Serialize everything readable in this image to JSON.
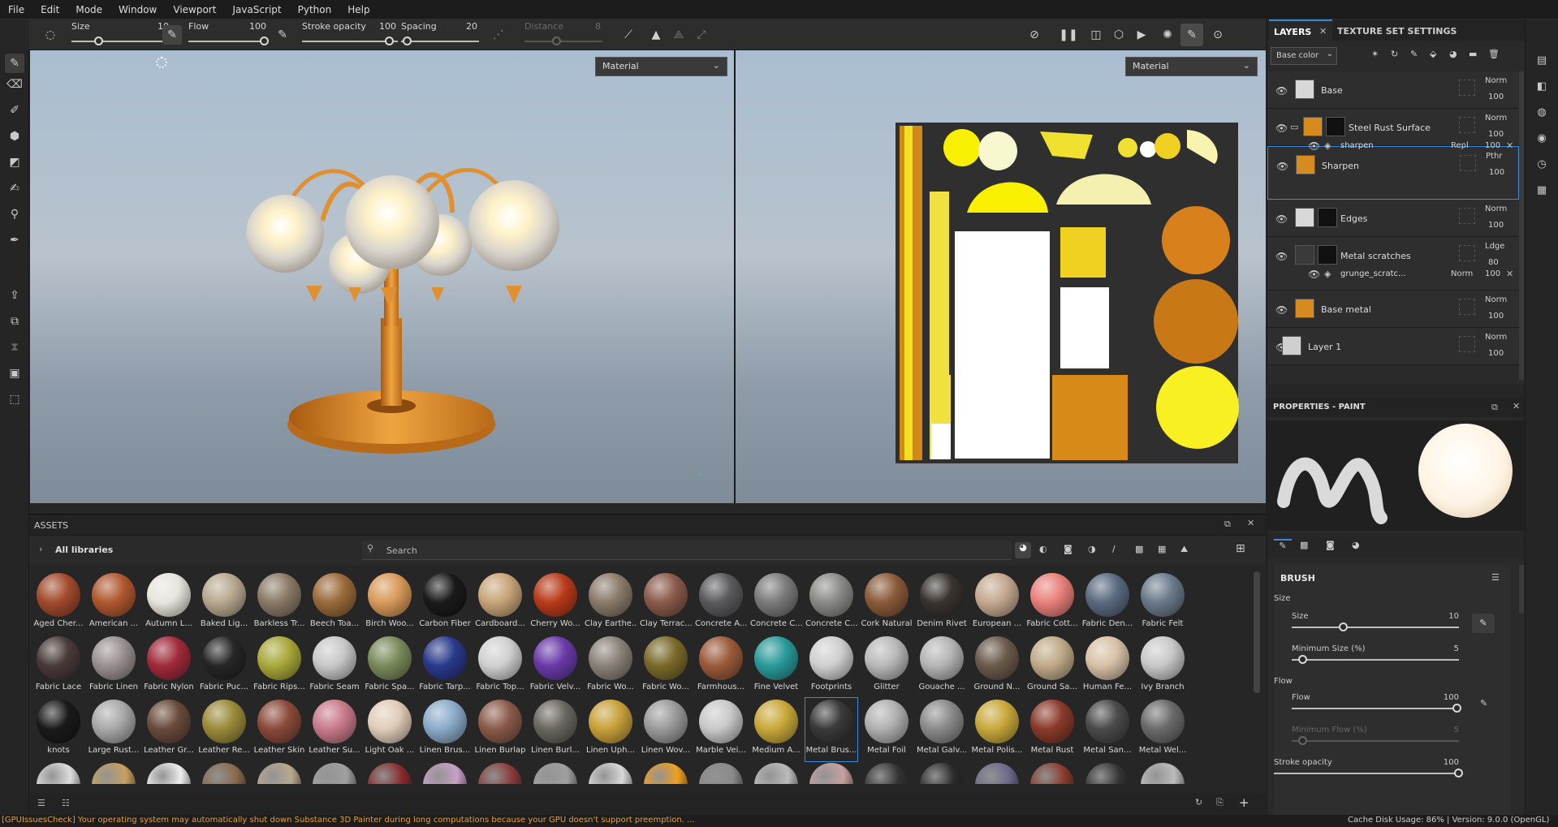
{
  "menu": [
    "File",
    "Edit",
    "Mode",
    "Window",
    "Viewport",
    "JavaScript",
    "Python",
    "Help"
  ],
  "toolbar": {
    "size_label": "Size",
    "size_value": "10",
    "flow_label": "Flow",
    "flow_value": "100",
    "opacity_label": "Stroke opacity",
    "opacity_value": "100",
    "spacing_label": "Spacing",
    "spacing_value": "20",
    "distance_label": "Distance",
    "distance_value": "8"
  },
  "viewport": {
    "left_mode": "Material",
    "right_mode": "Material"
  },
  "layers_panel": {
    "tab_layers": "LAYERS",
    "tab_texture": "TEXTURE SET SETTINGS",
    "channel": "Base color",
    "layers": [
      {
        "name": "Base",
        "blend": "Norm",
        "opacity": "100",
        "thumb": "#d8d8d8"
      },
      {
        "name": "Steel Rust Surface",
        "blend": "Norm",
        "opacity": "100",
        "thumb": "#d78a1e"
      },
      {
        "name": "Sharpen",
        "blend": "Pthr",
        "opacity": "100",
        "thumb": "#d78a1e"
      },
      {
        "name": "Edges",
        "blend": "Norm",
        "opacity": "100",
        "thumb": "#d8d8d8"
      },
      {
        "name": "Metal scratches",
        "blend": "Ldge",
        "opacity": "80",
        "thumb": "#3a3a3a"
      },
      {
        "name": "Base metal",
        "blend": "Norm",
        "opacity": "100",
        "thumb": "#d78a1e"
      },
      {
        "name": "Layer 1",
        "blend": "Norm",
        "opacity": "100",
        "thumb": "#cfcfcf"
      }
    ],
    "sublayers": [
      {
        "name": "sharpen",
        "blend": "Repl",
        "opacity": "100"
      },
      {
        "name": "grunge_scratc...",
        "blend": "Norm",
        "opacity": "100"
      }
    ]
  },
  "properties": {
    "title": "PROPERTIES - PAINT",
    "brush_header": "BRUSH",
    "size_group": "Size",
    "size_label": "Size",
    "size_value": "10",
    "minsize_label": "Minimum Size (%)",
    "minsize_value": "5",
    "flow_group": "Flow",
    "flow_label": "Flow",
    "flow_value": "100",
    "minflow_label": "Minimum Flow (%)",
    "minflow_value": "5",
    "opacity_label": "Stroke opacity",
    "opacity_value": "100"
  },
  "assets": {
    "title": "ASSETS",
    "libraries": "All libraries",
    "search_placeholder": "Search",
    "items": [
      {
        "label": "Aged Cher...",
        "c": "#a24a2c"
      },
      {
        "label": "American ...",
        "c": "#b0582f"
      },
      {
        "label": "Autumn L...",
        "c": "#e8e4de"
      },
      {
        "label": "Baked Lig...",
        "c": "#b8a890"
      },
      {
        "label": "Barkless Tr...",
        "c": "#8a7a66"
      },
      {
        "label": "Beech Toa...",
        "c": "#9a6a3a"
      },
      {
        "label": "Birch Woo...",
        "c": "#d89a5a"
      },
      {
        "label": "Carbon Fiber",
        "c": "#1a1a1a"
      },
      {
        "label": "Cardboard...",
        "c": "#c8a478"
      },
      {
        "label": "Cherry Wo...",
        "c": "#b83a1a"
      },
      {
        "label": "Clay Earthe...",
        "c": "#8a7a6a"
      },
      {
        "label": "Clay Terrac...",
        "c": "#8a5a4a"
      },
      {
        "label": "Concrete A...",
        "c": "#5a5a5e"
      },
      {
        "label": "Concrete C...",
        "c": "#7a7a7a"
      },
      {
        "label": "Concrete C...",
        "c": "#8a8a86"
      },
      {
        "label": "Cork Natural",
        "c": "#8a5a3a"
      },
      {
        "label": "Denim Rivet",
        "c": "#3a3430"
      },
      {
        "label": "European ...",
        "c": "#c4a890"
      },
      {
        "label": "Fabric Cott...",
        "c": "#e8807a"
      },
      {
        "label": "Fabric Den...",
        "c": "#5a6a80"
      },
      {
        "label": "Fabric Felt",
        "c": "#6a7a8a"
      },
      {
        "label": "Fabric Lace",
        "c": "#4a3a3a"
      },
      {
        "label": "Fabric Linen",
        "c": "#9a9090"
      },
      {
        "label": "Fabric Nylon",
        "c": "#a02a3a"
      },
      {
        "label": "Fabric Puc...",
        "c": "#262626"
      },
      {
        "label": "Fabric Rips...",
        "c": "#a8a83a"
      },
      {
        "label": "Fabric Seam",
        "c": "#c8c8c8"
      },
      {
        "label": "Fabric Spa...",
        "c": "#7a8a5a"
      },
      {
        "label": "Fabric Tarp...",
        "c": "#2a3a8a"
      },
      {
        "label": "Fabric Top...",
        "c": "#d0d0d0"
      },
      {
        "label": "Fabric Velv...",
        "c": "#6a3aa8"
      },
      {
        "label": "Fabric Wo...",
        "c": "#8a8278"
      },
      {
        "label": "Fabric Wo...",
        "c": "#7a6a2a"
      },
      {
        "label": "Farmhous...",
        "c": "#9a5a3a"
      },
      {
        "label": "Fine Velvet",
        "c": "#2a9a9a"
      },
      {
        "label": "Footprints",
        "c": "#cfcfcf"
      },
      {
        "label": "Glitter",
        "c": "#b8b8b8"
      },
      {
        "label": "Gouache ...",
        "c": "#b4b4b4"
      },
      {
        "label": "Ground N...",
        "c": "#6a5a4a"
      },
      {
        "label": "Ground Sa...",
        "c": "#c0aa88"
      },
      {
        "label": "Human Fe...",
        "c": "#d8c0a8"
      },
      {
        "label": "Ivy Branch",
        "c": "#c8c8c8"
      },
      {
        "label": "knots",
        "c": "#1a1a1a"
      },
      {
        "label": "Large Rust...",
        "c": "#a8a8a8"
      },
      {
        "label": "Leather Gr...",
        "c": "#6a4a3a"
      },
      {
        "label": "Leather Re...",
        "c": "#9a8a3a"
      },
      {
        "label": "Leather Skin",
        "c": "#8a4a3a"
      },
      {
        "label": "Leather Su...",
        "c": "#c87a8a"
      },
      {
        "label": "Light Oak ...",
        "c": "#e0ccb8"
      },
      {
        "label": "Linen Brus...",
        "c": "#8aaac8"
      },
      {
        "label": "Linen Burlap",
        "c": "#8a5a4a"
      },
      {
        "label": "Linen Burl...",
        "c": "#6a6660"
      },
      {
        "label": "Linen Uph...",
        "c": "#c8a03a"
      },
      {
        "label": "Linen Wov...",
        "c": "#9a9a9a"
      },
      {
        "label": "Marble Vei...",
        "c": "#c8c8c8"
      },
      {
        "label": "Medium A...",
        "c": "#c8a83a"
      },
      {
        "label": "Metal Brus...",
        "c": "#3a3a3a"
      },
      {
        "label": "Metal Foil",
        "c": "#b0b0b0"
      },
      {
        "label": "Metal Galv...",
        "c": "#8a8a8a"
      },
      {
        "label": "Metal Polis...",
        "c": "#c8a83a"
      },
      {
        "label": "Metal Rust",
        "c": "#8a3a2a"
      },
      {
        "label": "Metal San...",
        "c": "#4a4a4a"
      },
      {
        "label": "Metal Wel...",
        "c": "#6a6a6a"
      }
    ]
  },
  "status": {
    "message": "[GPUIssuesCheck] Your operating system may automatically shut down Substance 3D Painter during long computations because your GPU doesn't support preemption.  ...",
    "cache": "Cache Disk Usage:   86% | Version: 9.0.0 (OpenGL)",
    "warn_color": "#e0a040"
  }
}
